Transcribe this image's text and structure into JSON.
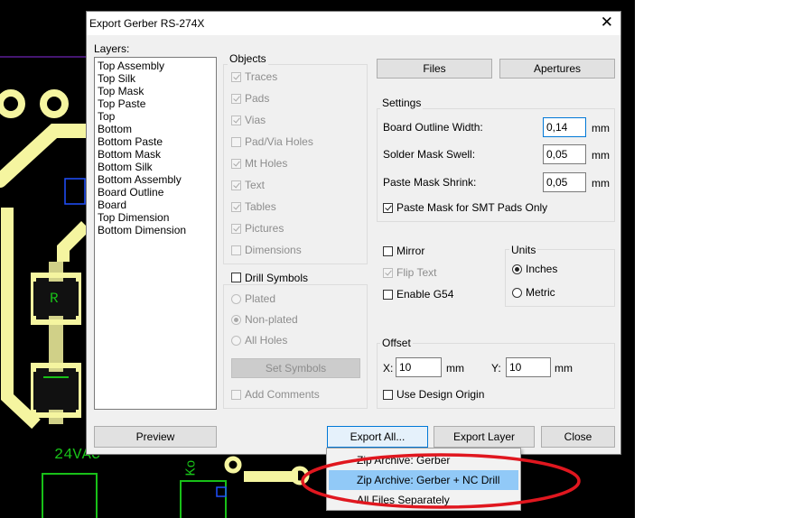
{
  "dialog": {
    "title": "Export Gerber RS-274X",
    "close_glyph": "✕"
  },
  "layers": {
    "label": "Layers:",
    "items": [
      "Top Assembly",
      "Top Silk",
      "Top Mask",
      "Top Paste",
      "Top",
      "Bottom",
      "Bottom Paste",
      "Bottom Mask",
      "Bottom Silk",
      "Bottom Assembly",
      "Board Outline",
      "Board",
      "Top Dimension",
      "Bottom Dimension"
    ]
  },
  "objects": {
    "label": "Objects",
    "items": [
      {
        "label": "Traces",
        "checked": true
      },
      {
        "label": "Pads",
        "checked": true
      },
      {
        "label": "Vias",
        "checked": true
      },
      {
        "label": "Pad/Via Holes",
        "checked": false
      },
      {
        "label": "Mt Holes",
        "checked": true
      },
      {
        "label": "Text",
        "checked": true
      },
      {
        "label": "Tables",
        "checked": true
      },
      {
        "label": "Pictures",
        "checked": true
      },
      {
        "label": "Dimensions",
        "checked": false
      }
    ]
  },
  "drill": {
    "label": "Drill Symbols",
    "radios": [
      {
        "label": "Plated",
        "checked": false
      },
      {
        "label": "Non-plated",
        "checked": true
      },
      {
        "label": "All Holes",
        "checked": false
      }
    ],
    "set_symbols": "Set Symbols",
    "add_comments": "Add Comments"
  },
  "top_buttons": {
    "files": "Files",
    "apertures": "Apertures"
  },
  "settings": {
    "label": "Settings",
    "board_outline_label": "Board Outline Width:",
    "board_outline_value": "0,14",
    "solder_mask_label": "Solder Mask Swell:",
    "solder_mask_value": "0,05",
    "paste_mask_label": "Paste Mask Shrink:",
    "paste_mask_value": "0,05",
    "unit": "mm",
    "smt_only_label": "Paste Mask for SMT Pads Only"
  },
  "options": {
    "mirror": "Mirror",
    "flip_text": "Flip Text",
    "enable_g54": "Enable G54"
  },
  "units": {
    "label": "Units",
    "inches": "Inches",
    "metric": "Metric"
  },
  "offset": {
    "label": "Offset",
    "x_label": "X:",
    "x_value": "10",
    "y_label": "Y:",
    "y_value": "10",
    "unit": "mm",
    "use_design_origin": "Use Design Origin"
  },
  "bottom_buttons": {
    "preview": "Preview",
    "export_all": "Export All...",
    "export_layer": "Export Layer",
    "close": "Close"
  },
  "dropdown": {
    "items": [
      "Zip Archive: Gerber",
      "Zip Archive: Gerber + NC Drill",
      "All Files Separately"
    ],
    "highlighted_index": 1
  },
  "pcb_labels": {
    "resistor": "R",
    "vac": "24VAC",
    "k": "Ko"
  },
  "colors": {
    "pcb_silk": "#f5f5a0",
    "pcb_green": "#18c018",
    "annotation": "#e0171f",
    "highlight": "#91c9f7",
    "focus": "#0078d7"
  }
}
